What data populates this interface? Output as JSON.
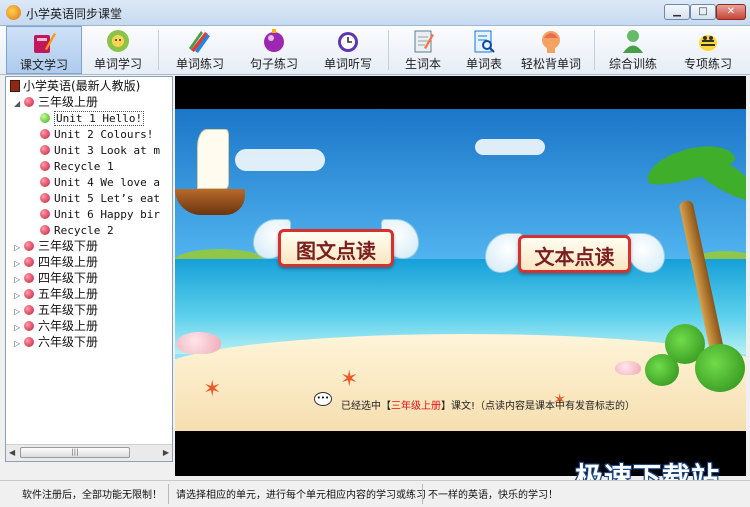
{
  "window": {
    "title": "小学英语同步课堂",
    "min_label": "▁",
    "max_label": "□",
    "close_label": "✕"
  },
  "toolbar": {
    "items": [
      {
        "label": "课文学习",
        "icon": "book-pencil-icon",
        "active": true
      },
      {
        "label": "单词学习",
        "icon": "flower-icon"
      },
      {
        "label": "单词练习",
        "icon": "pencils-icon"
      },
      {
        "label": "句子练习",
        "icon": "purple-orb-icon"
      },
      {
        "label": "单词听写",
        "icon": "clock-icon"
      },
      {
        "label": "生词本",
        "icon": "notepad-icon"
      },
      {
        "label": "单词表",
        "icon": "list-magnifier-icon"
      },
      {
        "label": "轻松背单词",
        "icon": "head-icon"
      },
      {
        "label": "综合训练",
        "icon": "person-icon"
      },
      {
        "label": "专项练习",
        "icon": "bee-icon"
      }
    ]
  },
  "tree": {
    "root": "小学英语(最新人教版)",
    "grade_open": "三年级上册",
    "units": [
      "Unit 1 Hello!",
      "Unit 2 Colours!",
      "Unit 3 Look at m",
      "Recycle 1",
      "Unit 4 We love a",
      "Unit 5 Let’s eat",
      "Unit 6 Happy bir",
      "Recycle 2"
    ],
    "selected_index": 0,
    "other_grades": [
      "三年级下册",
      "四年级上册",
      "四年级下册",
      "五年级上册",
      "五年级下册",
      "六年级上册",
      "六年级下册"
    ]
  },
  "content": {
    "button_picture": "图文点读",
    "button_text": "文本点读",
    "notice_prefix": "已经选中【",
    "notice_selected": "三年级上册",
    "notice_suffix": "】课文!（点读内容是课本中有发音标志的）"
  },
  "status": {
    "left": "软件注册后，全部功能无限制！",
    "middle": "请选择相应的单元，进行每个单元相应内容的学习或练习",
    "right": "不一样的英语，快乐的学习！"
  },
  "watermark": "极速下载站",
  "colors": {
    "accent": "#d8312d",
    "sky_top": "#1b76c8",
    "toolbar_active": "#aecbed"
  }
}
